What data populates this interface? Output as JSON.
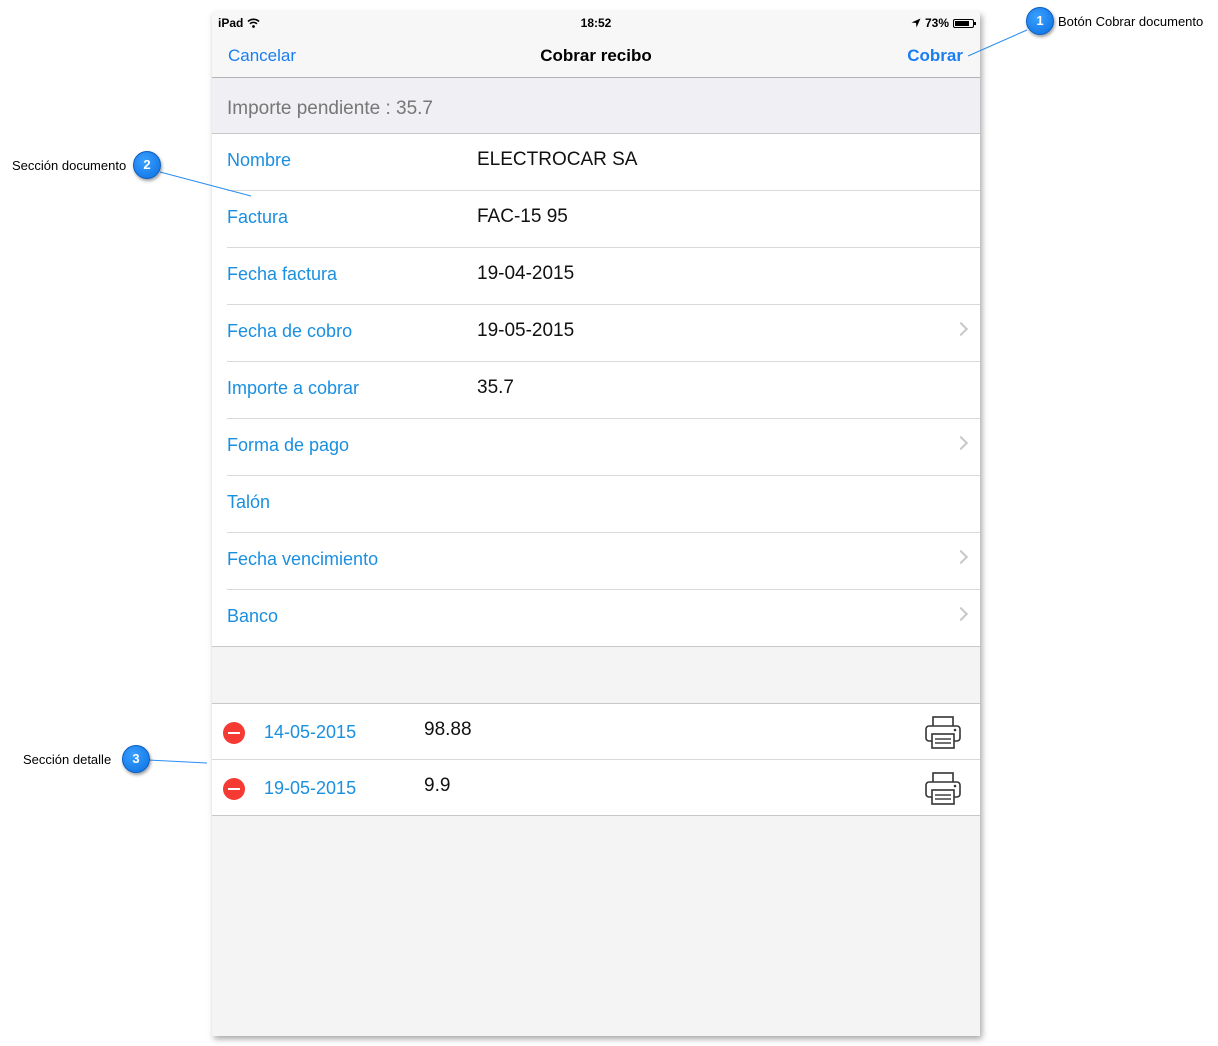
{
  "status_bar": {
    "device": "iPad",
    "time": "18:52",
    "battery": "73%"
  },
  "nav": {
    "cancel": "Cancelar",
    "title": "Cobrar recibo",
    "action": "Cobrar"
  },
  "pending": "Importe pendiente : 35.7",
  "document_rows": [
    {
      "label": "Nombre",
      "value": "ELECTROCAR SA",
      "disclosure": false
    },
    {
      "label": "Factura",
      "value": "FAC-15 95",
      "disclosure": false
    },
    {
      "label": "Fecha factura",
      "value": "19-04-2015",
      "disclosure": false
    },
    {
      "label": "Fecha de cobro",
      "value": "19-05-2015",
      "disclosure": true
    },
    {
      "label": "Importe a cobrar",
      "value": "35.7",
      "disclosure": false
    },
    {
      "label": "Forma de pago",
      "value": "",
      "disclosure": true
    },
    {
      "label": "Talón",
      "value": "",
      "disclosure": false
    },
    {
      "label": "Fecha vencimiento",
      "value": "",
      "disclosure": true
    },
    {
      "label": "Banco",
      "value": "",
      "disclosure": true
    }
  ],
  "detail_rows": [
    {
      "date": "14-05-2015",
      "amount": "98.88"
    },
    {
      "date": "19-05-2015",
      "amount": "9.9"
    }
  ],
  "callouts": [
    {
      "number": "1",
      "label": "Botón Cobrar documento"
    },
    {
      "number": "2",
      "label": "Sección documento"
    },
    {
      "number": "3",
      "label": "Sección detalle"
    }
  ],
  "colors": {
    "accent": "#1a7ef0",
    "delete": "#f43a33",
    "callout": "#1a84f5"
  }
}
